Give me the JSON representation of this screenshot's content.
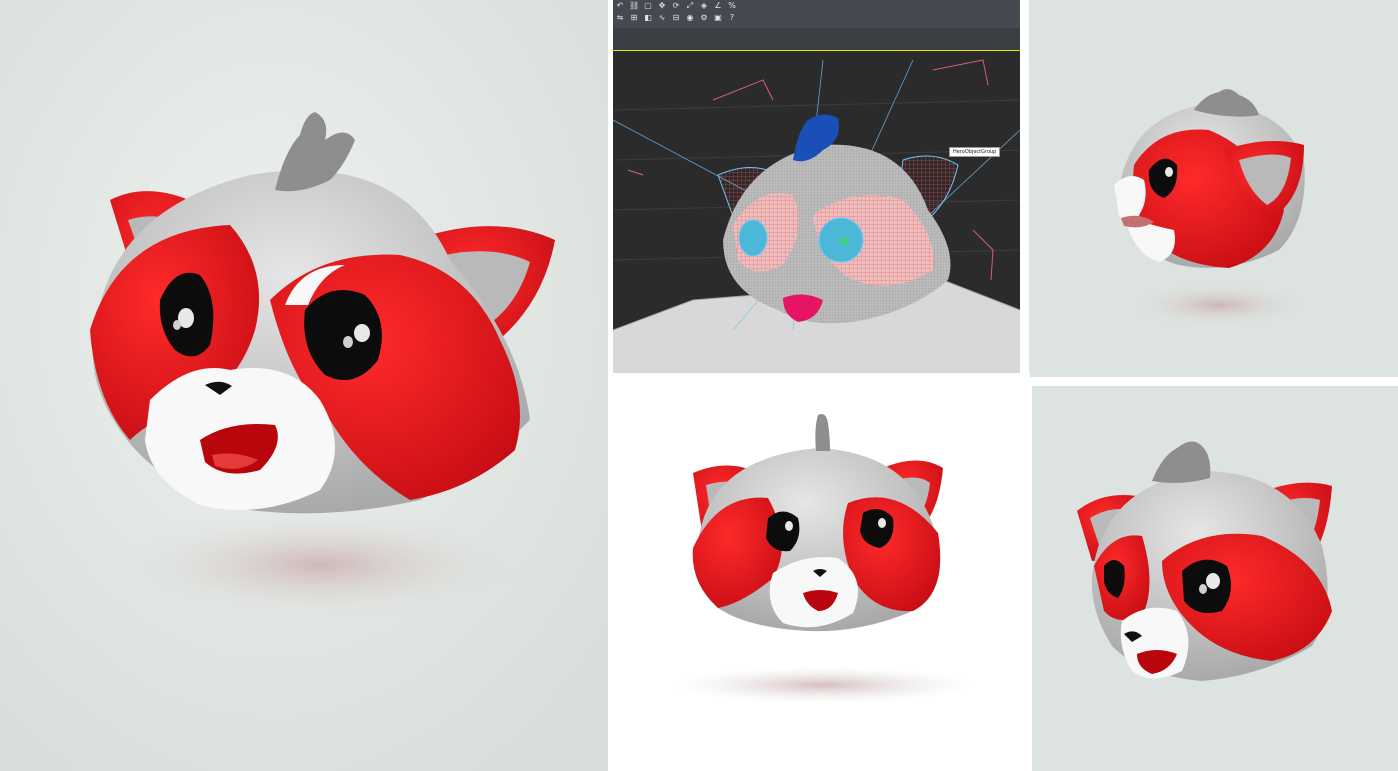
{
  "viewport": {
    "object_label": "HeroObjectGroup",
    "toolbar_icons": [
      "undo-icon",
      "link-icon",
      "select-icon",
      "move-icon",
      "rotate-icon",
      "scale-icon",
      "snap-icon",
      "angle-snap-icon",
      "percent-snap-icon",
      "mirror-icon",
      "align-icon",
      "layer-icon",
      "curve-editor-icon",
      "schematic-icon",
      "material-editor-icon",
      "render-setup-icon",
      "render-icon",
      "help-icon"
    ]
  },
  "colors": {
    "fur_red": "#e8141c",
    "fur_dark_red": "#b50d12",
    "fur_grey": "#c9c9c9",
    "fur_white": "#f7f7f7",
    "eye_black": "#0c0c0c",
    "background_light": "#dde3e0",
    "viewport_bg": "#2b2b2b",
    "wire_blue": "#6ec4ff"
  }
}
